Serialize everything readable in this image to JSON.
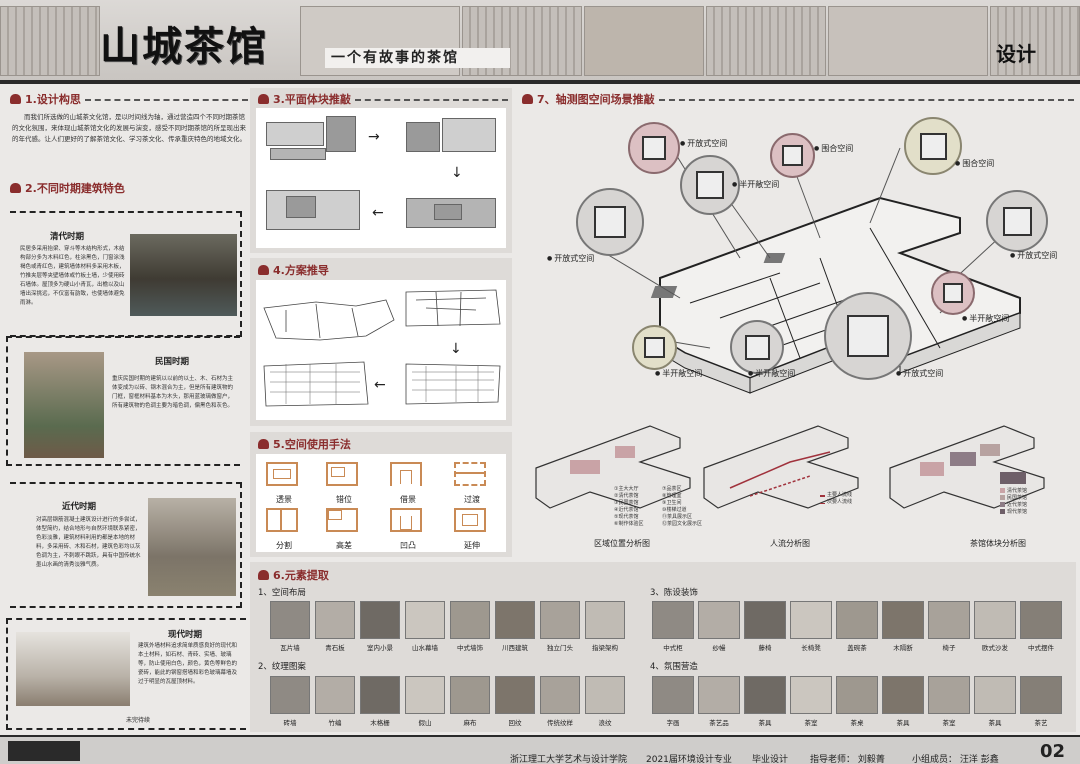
{
  "header": {
    "title": "山城茶馆",
    "subtitle": "一个有故事的茶馆",
    "design_label": "设计"
  },
  "sections": {
    "s1": "1.设计构思",
    "s2": "2.不同时期建筑特色",
    "s3": "3.平面体块推敲",
    "s4": "4.方案推导",
    "s5": "5.空间使用手法",
    "s6": "6.元素提取",
    "s7": "7、轴测图空间场景推敲"
  },
  "concept_text": "而我们所选做的山城茶文化馆，是以时间线为轴，通过营造四个不同时期茶馆的文化氛围，来体现山城茶馆文化的发展与演变，感受不同时期茶馆的所呈现出来的年代感。让人们更好的了解茶馆文化、学习茶文化、传承重庆特色的地域文化。",
  "eras": [
    {
      "title": "清代时期",
      "text": "民居多采用抬梁、穿斗等木结构形式，木结构部分多为木料红色，柱涂黑色，门窗涂浅褐色或青红色，建筑墙体材料多采用木板，竹推夹层等夹壁墙体或竹板土墙，少使用砖石墙体。屋顶多为硬山小青瓦，出檐以及山墙出深挑远，不仅富有韵致，也使墙体避免雨淋。"
    },
    {
      "title": "民国时期",
      "text": "重庆民国时期的建筑以以前的以土、木、石材为主体变成为以砖、钢木混合为主，但是所有建筑物的门框，窗框材料基本为木头，那用蓝玻璃做窗户，所有建筑物的色调主要为暗色调，偏黑色和灰色。"
    },
    {
      "title": "近代时期",
      "text": "对高层钢筋混凝土建筑设计进行的多尝试，体型简约，结合地形与自然环境联系紧密，色彩淡雅，建筑材料利用的都是本地的材料，多采用砖、木和石材，建筑色彩均以灰色调为主，不刺眼不跳跃，具有中国传统水墨山水画的清秀淡雅气质。"
    },
    {
      "title": "现代时期",
      "text": "建筑外墙材料追求简单质感良好的现代和本土材料，如石材、青砖、实墙、玻璃等，防止使用白色，颜色，黄色等鲜色的瓷砖，能此的钢窗搭墙和彩色玻璃幕墙及过于明显的瓦屋顶材料。"
    }
  ],
  "unfinished": "未完待续",
  "space_methods": [
    "透景",
    "错位",
    "借景",
    "过渡",
    "分割",
    "高差",
    "凹凸",
    "延伸"
  ],
  "axon_labels": [
    "开放式空间",
    "围合空间",
    "围合空间",
    "半开敞空间",
    "开放式空间",
    "开放式空间",
    "半开敞空间",
    "半开敞空间",
    "半开敞空间",
    "开放式空间"
  ],
  "analysis": {
    "titles": [
      "区域位置分析图",
      "人流分析图",
      "茶馆体块分析图"
    ],
    "zones": [
      "①主大大厅",
      "②清代茶馆",
      "③民国茶馆",
      "④近代茶馆",
      "⑤现代茶馆",
      "⑥制作体验区",
      "⑦品茶区",
      "⑧管理室",
      "⑨卫生间",
      "⑩楼梯过道",
      "⑪茶具展示区",
      "⑫茶园文化展示区"
    ],
    "flow": [
      "主要人流线",
      "次要人流线"
    ],
    "blocks": [
      "清代茶馆",
      "民国茶馆",
      "近代茶馆",
      "现代茶馆"
    ]
  },
  "elements": {
    "g1": "1、空间布局",
    "g2": "2、纹理图案",
    "g3": "3、陈设装饰",
    "g4": "4、氛围营造",
    "layout": [
      "瓦片墙",
      "青石板",
      "室内小景",
      "山水幕墙",
      "中式墙饰",
      "川西建筑",
      "独立门头",
      "指梁架构"
    ],
    "pattern": [
      "砖墙",
      "竹编",
      "木格栅",
      "假山",
      "麻布",
      "回纹",
      "传统纹样",
      "浪纹"
    ],
    "decor": [
      "中式柜",
      "纱幔",
      "藤椅",
      "长椅凳",
      "盖碗茶",
      "木隔断",
      "椅子",
      "欧式沙发",
      "中式摆件"
    ],
    "atmos": [
      "字画",
      "茶艺品",
      "茶具",
      "茶室",
      "茶桌",
      "茶具",
      "茶室",
      "茶具",
      "茶艺"
    ]
  },
  "footer": {
    "school": "浙江理工大学艺术与设计学院",
    "major": "2021届环境设计专业",
    "graduation": "毕业设计",
    "advisor": "指导老师：  刘毅菁",
    "members": "小组成员：  汪洋   彭鑫",
    "page": "02"
  }
}
